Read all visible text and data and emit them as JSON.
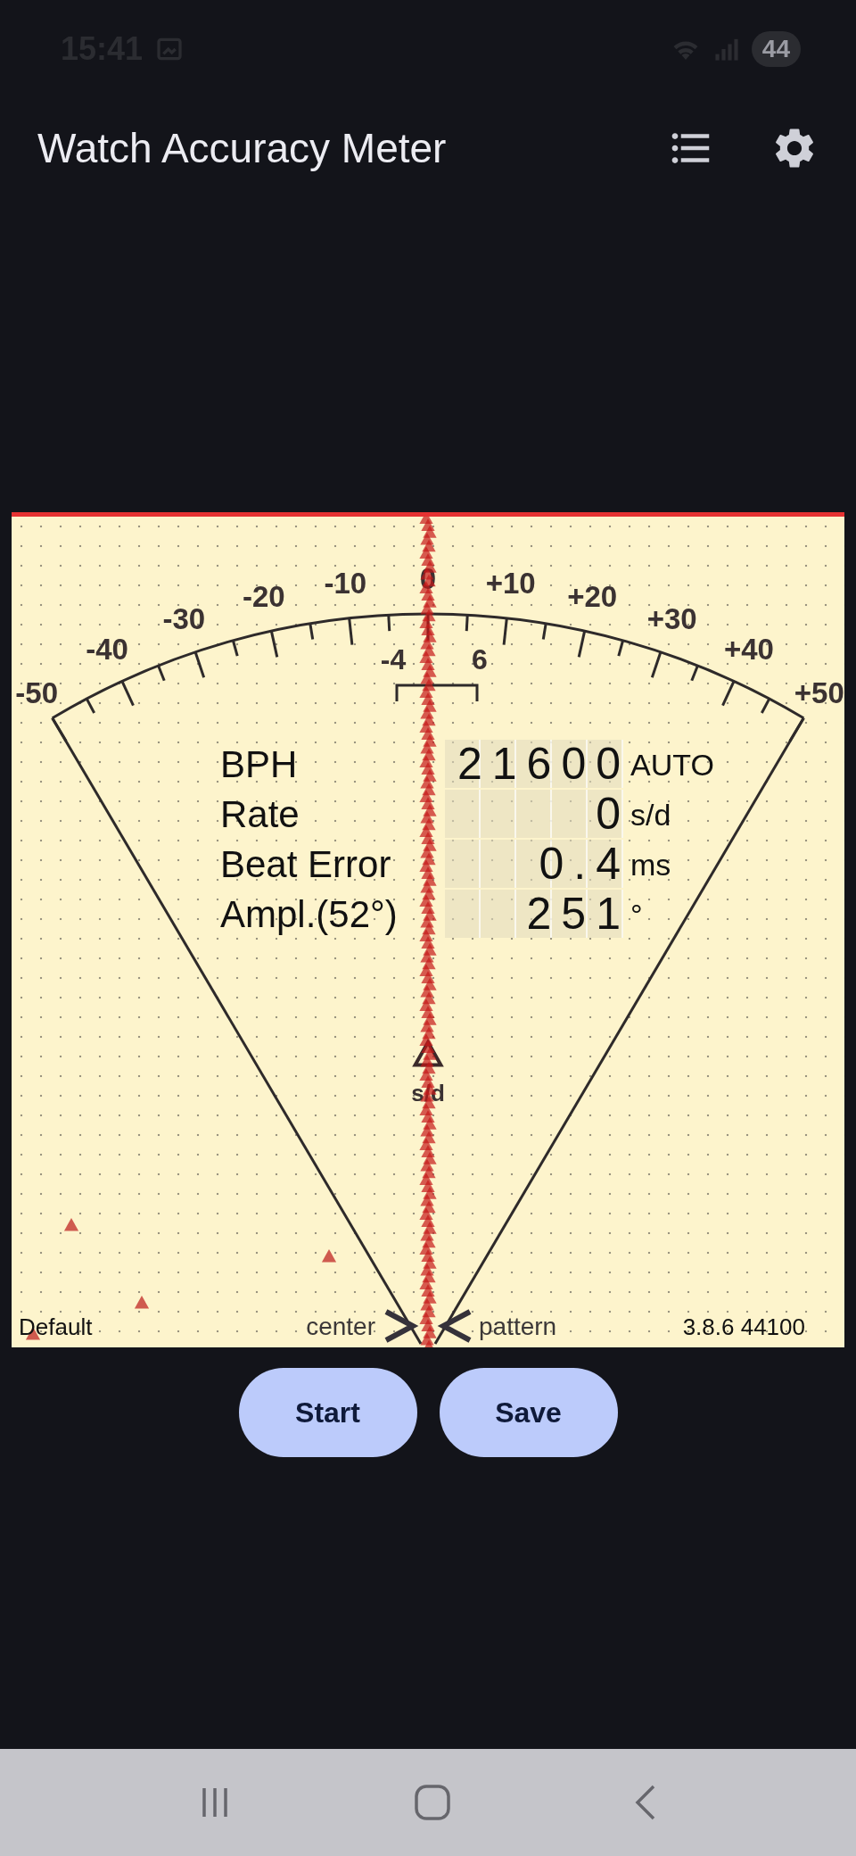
{
  "status_bar": {
    "time": "15:41",
    "battery": "44"
  },
  "app_bar": {
    "title": "Watch Accuracy Meter"
  },
  "gauge": {
    "scale_labels": [
      "-50",
      "-40",
      "-30",
      "-20",
      "-10",
      "0",
      "+10",
      "+20",
      "+30",
      "+40",
      "+50"
    ],
    "window_labels": [
      "-4",
      "6"
    ],
    "trace_unit": "s/d",
    "readings": [
      {
        "label": "BPH",
        "value": "21600",
        "unit": "AUTO"
      },
      {
        "label": "Rate",
        "value": "0",
        "unit": "s/d"
      },
      {
        "label": "Beat Error",
        "value": "0.4",
        "unit": "ms"
      },
      {
        "label": "Ampl.(52°)",
        "value": "251",
        "unit": "°"
      }
    ],
    "profile": "Default",
    "center_label": "center",
    "pattern_label": "pattern",
    "version": "3.8.6 44100"
  },
  "buttons": [
    "Start",
    "Save"
  ]
}
